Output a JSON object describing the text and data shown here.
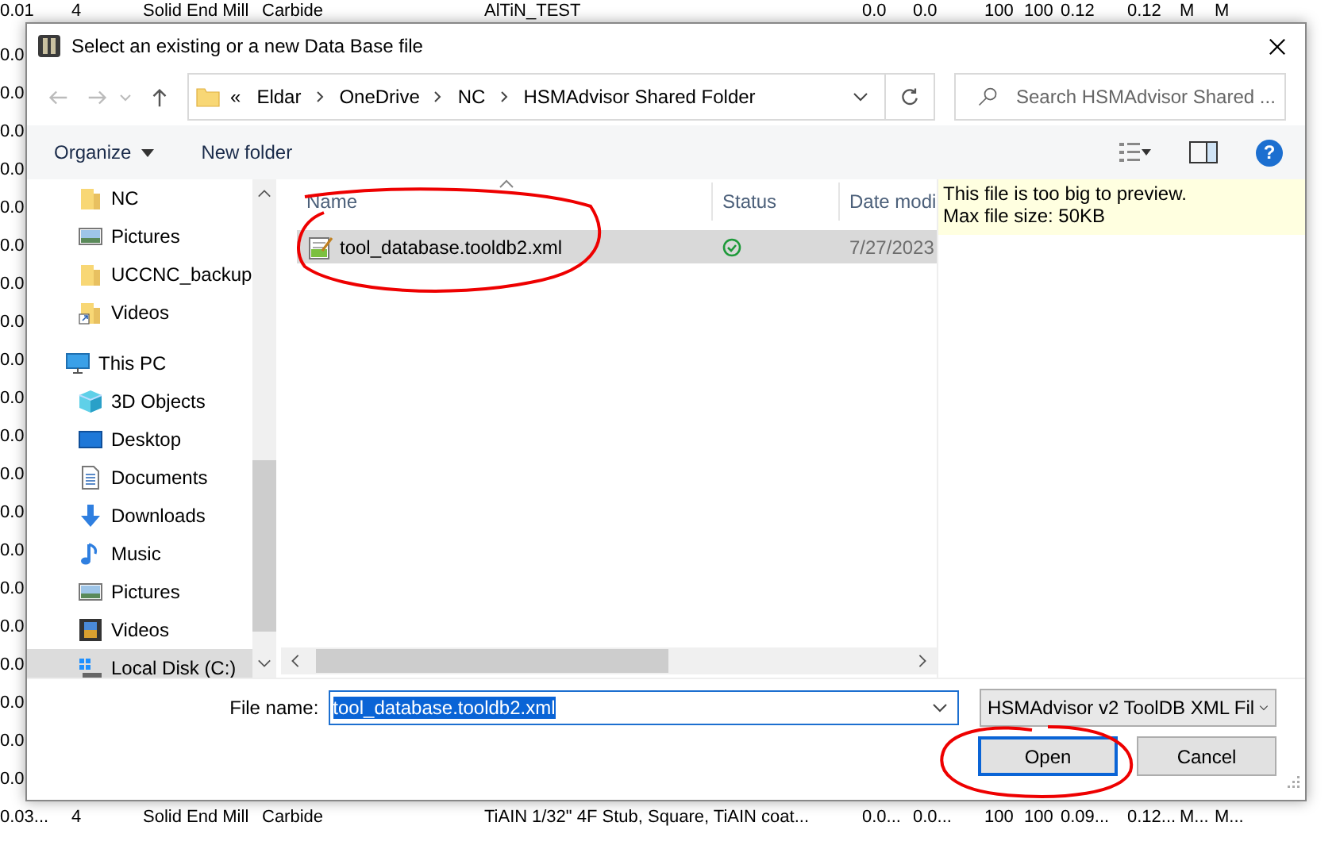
{
  "background_table": {
    "rows": [
      {
        "cells": [
          "0.01",
          "4",
          "Solid End Mill",
          "Carbide",
          "AlTiN_TEST",
          "",
          "0.0",
          "0.0",
          "100",
          "100",
          "0.12",
          "0.12",
          "M",
          "M"
        ]
      },
      {
        "cells": [
          "0.0"
        ]
      },
      {
        "cells": [
          "0.0"
        ]
      },
      {
        "cells": [
          "0.0"
        ]
      },
      {
        "cells": [
          "0.0"
        ]
      },
      {
        "cells": [
          "0.0"
        ]
      },
      {
        "cells": [
          "0.0"
        ]
      },
      {
        "cells": [
          "0.0"
        ]
      },
      {
        "cells": [
          "0.0"
        ]
      },
      {
        "cells": [
          "0.0"
        ]
      },
      {
        "cells": [
          "0.0"
        ]
      },
      {
        "cells": [
          "0.0"
        ]
      },
      {
        "cells": [
          "0.0"
        ]
      },
      {
        "cells": [
          "0.0"
        ]
      },
      {
        "cells": [
          "0.0"
        ]
      },
      {
        "cells": [
          "0.0"
        ]
      },
      {
        "cells": [
          "0.0"
        ]
      },
      {
        "cells": [
          "0.0"
        ]
      },
      {
        "cells": [
          "0.0"
        ]
      },
      {
        "cells": [
          "0.0"
        ]
      },
      {
        "cells": [
          "0.0"
        ]
      },
      {
        "cells": [
          "0.03...",
          "4",
          "Solid End Mill",
          "Carbide",
          "TiAIN",
          "1/32\" 4F Stub, Square, TiAIN coat...",
          "0.0...",
          "0.0...",
          "100",
          "100",
          "0.09...",
          "0.12...",
          "M...",
          "M..."
        ]
      }
    ]
  },
  "dialog": {
    "title": "Select an existing or a new Data Base file",
    "address": {
      "overflow_mark": "«",
      "path": [
        "Eldar",
        "OneDrive",
        "NC",
        "HSMAdvisor Shared Folder"
      ]
    },
    "search": {
      "placeholder": "Search HSMAdvisor Shared ..."
    },
    "toolbar": {
      "organize": "Organize",
      "new_folder": "New folder",
      "help": "?"
    },
    "sidebar": {
      "groups": [
        {
          "children": [
            {
              "label": "NC",
              "kind": "folder",
              "selected": false
            },
            {
              "label": "Pictures",
              "kind": "pictures",
              "selected": false
            },
            {
              "label": "UCCNC_backup",
              "kind": "folder",
              "selected": false
            },
            {
              "label": "Videos",
              "kind": "shortcut",
              "selected": false
            }
          ]
        },
        {
          "label": "This PC",
          "kind": "pc",
          "children": [
            {
              "label": "3D Objects",
              "kind": "objects",
              "selected": false
            },
            {
              "label": "Desktop",
              "kind": "desktop",
              "selected": false
            },
            {
              "label": "Documents",
              "kind": "documents",
              "selected": false
            },
            {
              "label": "Downloads",
              "kind": "downloads",
              "selected": false
            },
            {
              "label": "Music",
              "kind": "music",
              "selected": false
            },
            {
              "label": "Pictures",
              "kind": "pictures",
              "selected": false
            },
            {
              "label": "Videos",
              "kind": "videos",
              "selected": false
            },
            {
              "label": "Local Disk (C:)",
              "kind": "disk",
              "selected": true
            }
          ]
        }
      ]
    },
    "file_list": {
      "columns": [
        "Name",
        "Status",
        "Date modi"
      ],
      "rows": [
        {
          "name": "tool_database.tooldb2.xml",
          "synced": true,
          "date": "7/27/2023",
          "selected": true
        }
      ]
    },
    "preview": {
      "lines": [
        "This file is too big to preview.",
        "Max file size: 50KB"
      ]
    },
    "file_name": {
      "label": "File name:",
      "value": "tool_database.tooldb2.xml",
      "value_selected": true
    },
    "file_type": "HSMAdvisor v2 ToolDB XML Fil",
    "buttons": [
      {
        "label": "Open",
        "default": true
      },
      {
        "label": "Cancel",
        "default": false
      }
    ]
  }
}
